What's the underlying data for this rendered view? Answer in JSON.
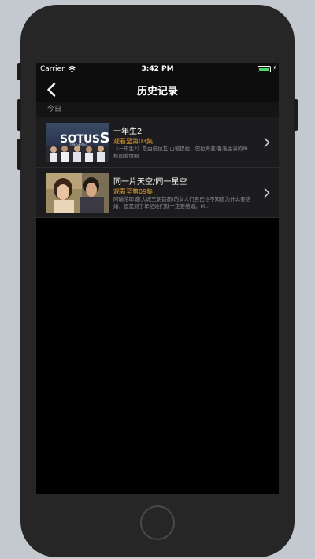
{
  "status_bar": {
    "carrier": "Carrier",
    "time": "3:42 PM",
    "battery_level": 1.0,
    "wifi_icon": "wifi-icon",
    "charging_icon": "bolt-icon"
  },
  "nav": {
    "title": "历史记录",
    "back_icon": "chevron-left-icon"
  },
  "section": {
    "label": "今日"
  },
  "items": [
    {
      "title": "一年生2",
      "progress": "观看至第03集",
      "description": "《一年生2》是由皮拉瓦·山玻提拉、巴拉奇亚·鲁洛主演的BL校园爱情剧",
      "thumbnail_text": "SOTUS",
      "thumbnail_subtext": "THE SERIES",
      "thumbnail_badge": "S"
    },
    {
      "title": "同一片天空/同一星空",
      "progress": "观看至第09集",
      "description": "阿瑜陀耶城(大城王朝首都)的女人们自己也不知道为什么要结婚，但是到了年纪她们就一定要结婚。M..."
    }
  ],
  "colors": {
    "accent": "#e6a02c",
    "background": "#000000",
    "row_background": "#1c1c1e",
    "battery": "#4cd964"
  }
}
